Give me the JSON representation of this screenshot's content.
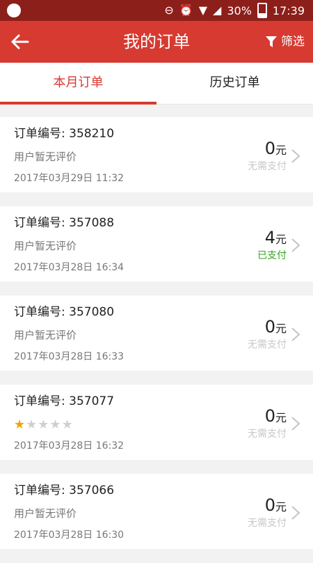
{
  "status_bar": {
    "battery_percent": "30%",
    "time": "17:39"
  },
  "header": {
    "title": "我的订单",
    "filter_label": "筛选"
  },
  "tabs": [
    {
      "label": "本月订单",
      "active": true
    },
    {
      "label": "历史订单",
      "active": false
    }
  ],
  "orders": [
    {
      "order_label": "订单编号: 358210",
      "review": "用户暂无评价",
      "time": "2017年03月29日 11:32",
      "amount": "0",
      "unit": "元",
      "payment": "无需支付"
    },
    {
      "order_label": "订单编号: 357088",
      "review": "用户暂无评价",
      "time": "2017年03月28日 16:34",
      "amount": "4",
      "unit": "元",
      "payment": "已支付"
    },
    {
      "order_label": "订单编号: 357080",
      "review": "用户暂无评价",
      "time": "2017年03月28日 16:33",
      "amount": "0",
      "unit": "元",
      "payment": "无需支付"
    },
    {
      "order_label": "订单编号: 357077",
      "rating": 1,
      "rating_max": 5,
      "time": "2017年03月28日 16:32",
      "amount": "0",
      "unit": "元",
      "payment": "无需支付"
    },
    {
      "order_label": "订单编号: 357066",
      "review": "用户暂无评价",
      "time": "2017年03月28日 16:30",
      "amount": "0",
      "unit": "元",
      "payment": "无需支付"
    }
  ],
  "colors": {
    "brand": "#d63a31",
    "status_bar": "#8c1f1a",
    "paid": "#33a11e",
    "star_on": "#f0a500"
  }
}
